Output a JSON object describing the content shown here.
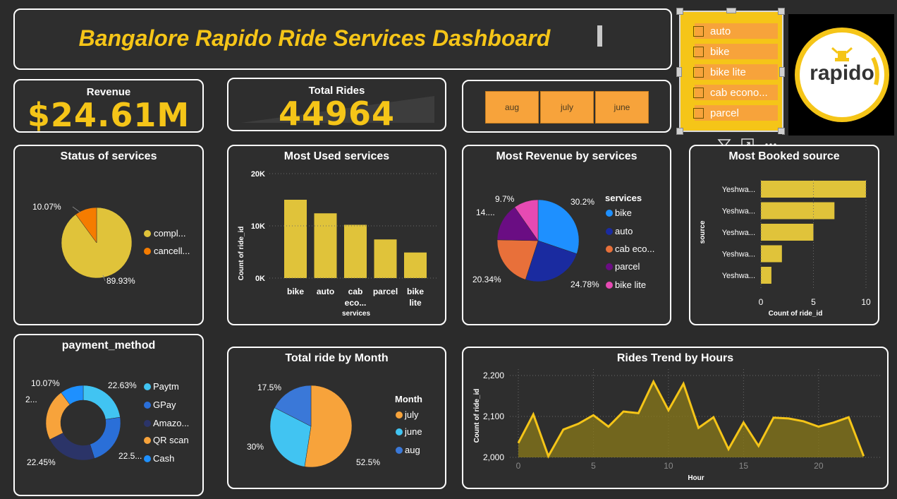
{
  "header": {
    "title": "Bangalore Rapido Ride Services Dashboard"
  },
  "kpis": {
    "revenue": {
      "label": "Revenue",
      "value": "$24.61M"
    },
    "total_rides": {
      "label": "Total Rides",
      "value": "44964"
    }
  },
  "month_slicer": {
    "options": [
      "aug",
      "july",
      "june"
    ]
  },
  "service_slicer": {
    "options": [
      "auto",
      "bike",
      "bike lite",
      "cab econo...",
      "parcel"
    ]
  },
  "logo": {
    "text": "rapido"
  },
  "colors": {
    "accent": "#f5c518",
    "orange": "#f7a33b",
    "card_bg": "#2e2e2e",
    "page_bg": "#2b2b2b"
  },
  "status_chart": {
    "title": "Status of services",
    "legend": [
      "compl...",
      "cancell..."
    ],
    "labels": [
      "89.93%",
      "10.07%"
    ]
  },
  "used_chart": {
    "title": "Most Used services",
    "ylabel": "Count of ride_id",
    "xlabel": "services",
    "ticks": [
      "0K",
      "10K",
      "20K"
    ],
    "cat_labels": [
      [
        "bike"
      ],
      [
        "auto"
      ],
      [
        "cab",
        "eco..."
      ],
      [
        "parcel"
      ],
      [
        "bike",
        "lite"
      ]
    ]
  },
  "revenue_chart": {
    "title": "Most Revenue by services",
    "legend_title": "services",
    "legend": [
      "bike",
      "auto",
      "cab eco...",
      "parcel",
      "bike lite"
    ],
    "labels": [
      "30.2%",
      "24.78%",
      "20.34%",
      "14....",
      "9.7%"
    ]
  },
  "source_chart": {
    "title": "Most Booked source",
    "ylabel": "source",
    "xlabel": "Count of ride_id",
    "cat_labels": [
      "Yeshwa...",
      "Yeshwa...",
      "Yeshwa...",
      "Yeshwa...",
      "Yeshwa..."
    ],
    "ticks": [
      "0",
      "5",
      "10"
    ]
  },
  "payment_chart": {
    "title": "payment_method",
    "legend": [
      "Paytm",
      "GPay",
      "Amazo...",
      "QR scan",
      "Cash"
    ],
    "labels": [
      "22.63%",
      "22.5...",
      "22.45%",
      "2...",
      "10.07%"
    ]
  },
  "month_chart": {
    "title": "Total ride by Month",
    "legend_title": "Month",
    "legend": [
      "july",
      "june",
      "aug"
    ],
    "labels": [
      "52.5%",
      "30%",
      "17.5%"
    ]
  },
  "hours_chart": {
    "title": "Rides Trend by Hours",
    "ylabel": "Count of ride_id",
    "xlabel": "Hour",
    "yticks": [
      "2,000",
      "2,100",
      "2,200"
    ],
    "xticks": [
      "0",
      "5",
      "10",
      "15",
      "20"
    ]
  },
  "chart_data": [
    {
      "type": "pie",
      "title": "Status of services",
      "categories": [
        "compl...",
        "cancell..."
      ],
      "values": [
        89.93,
        10.07
      ],
      "colors": [
        "#e0c33a",
        "#f57c00"
      ]
    },
    {
      "type": "bar",
      "title": "Most Used services",
      "categories": [
        "bike",
        "auto",
        "cab eco...",
        "parcel",
        "bike lite"
      ],
      "values": [
        15000,
        12400,
        10200,
        7400,
        4900
      ],
      "xlabel": "services",
      "ylabel": "Count of ride_id",
      "ylim": [
        0,
        20000
      ],
      "color": "#e0c33a"
    },
    {
      "type": "pie",
      "title": "Most Revenue by services",
      "categories": [
        "bike",
        "auto",
        "cab eco...",
        "parcel",
        "bike lite"
      ],
      "values": [
        30.2,
        24.78,
        20.34,
        14.98,
        9.7
      ],
      "colors": [
        "#1e90ff",
        "#1a2ba0",
        "#e8703a",
        "#6a0d83",
        "#e64ab3"
      ]
    },
    {
      "type": "bar",
      "title": "Most Booked source",
      "orientation": "horizontal",
      "categories": [
        "Yeshwa...",
        "Yeshwa...",
        "Yeshwa...",
        "Yeshwa...",
        "Yeshwa..."
      ],
      "values": [
        10,
        7,
        5,
        2,
        1
      ],
      "xlabel": "Count of ride_id",
      "ylabel": "source",
      "xlim": [
        0,
        10
      ],
      "color": "#e0c33a"
    },
    {
      "type": "pie",
      "title": "payment_method",
      "donut": true,
      "categories": [
        "Paytm",
        "GPay",
        "Amazo...",
        "QR scan",
        "Cash"
      ],
      "values": [
        22.63,
        22.52,
        22.45,
        22.33,
        10.07
      ],
      "colors": [
        "#41c4f2",
        "#2a6fd8",
        "#2b3468",
        "#f7a33b",
        "#1e90ff"
      ]
    },
    {
      "type": "pie",
      "title": "Total ride by Month",
      "categories": [
        "july",
        "june",
        "aug"
      ],
      "values": [
        52.5,
        30,
        17.5
      ],
      "colors": [
        "#f7a33b",
        "#41c4f2",
        "#3a78d8"
      ]
    },
    {
      "type": "area",
      "title": "Rides Trend by Hours",
      "xlabel": "Hour",
      "ylabel": "Count of ride_id",
      "x": [
        0,
        1,
        2,
        3,
        4,
        5,
        6,
        7,
        8,
        9,
        10,
        11,
        12,
        13,
        14,
        15,
        16,
        17,
        18,
        19,
        20,
        21,
        22,
        23
      ],
      "values": [
        2035,
        2105,
        2003,
        2068,
        2082,
        2103,
        2075,
        2112,
        2108,
        2185,
        2115,
        2180,
        2072,
        2098,
        2020,
        2085,
        2028,
        2097,
        2095,
        2088,
        2075,
        2085,
        2098,
        2003
      ],
      "ylim": [
        2000,
        2230
      ],
      "xlim": [
        0,
        24
      ],
      "color": "#f5c518"
    }
  ]
}
